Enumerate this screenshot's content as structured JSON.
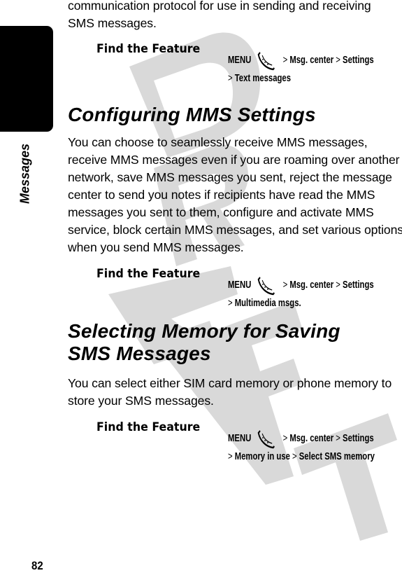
{
  "side_tab": {
    "label": "Messages"
  },
  "page_number": "82",
  "watermark": "DRAFT",
  "intro": {
    "text": "communication protocol for use in sending and receiving SMS messages."
  },
  "find_feature_1": {
    "label": "Find the Feature",
    "menu_key": "MENU",
    "menu_icon": "menu-key-icon",
    "path_line1": [
      "Msg. center",
      "Settings"
    ],
    "path_line2": [
      "Text messages"
    ]
  },
  "section_mms": {
    "heading": "Configuring MMS Settings",
    "body": "You can choose to seamlessly receive MMS messages, receive MMS messages even if you are roaming over another network, save MMS messages you sent, reject the message center to send you notes if recipients have read the MMS messages you sent to them, configure and activate MMS service, block certain MMS messages, and set various options when you send MMS messages."
  },
  "find_feature_2": {
    "label": "Find the Feature",
    "menu_key": "MENU",
    "path_line1": [
      "Msg. center",
      "Settings"
    ],
    "path_line2": [
      "Multimedia msgs."
    ]
  },
  "section_memory": {
    "heading_line1": "Selecting Memory for Saving",
    "heading_line2": "SMS Messages",
    "body": "You can select either SIM card memory or phone memory to store your SMS messages."
  },
  "find_feature_3": {
    "label": "Find the Feature",
    "menu_key": "MENU",
    "path_line1": [
      "Msg. center",
      "Settings"
    ],
    "path_line2": [
      "Memory in use",
      "Select SMS memory"
    ]
  },
  "separator": ">"
}
